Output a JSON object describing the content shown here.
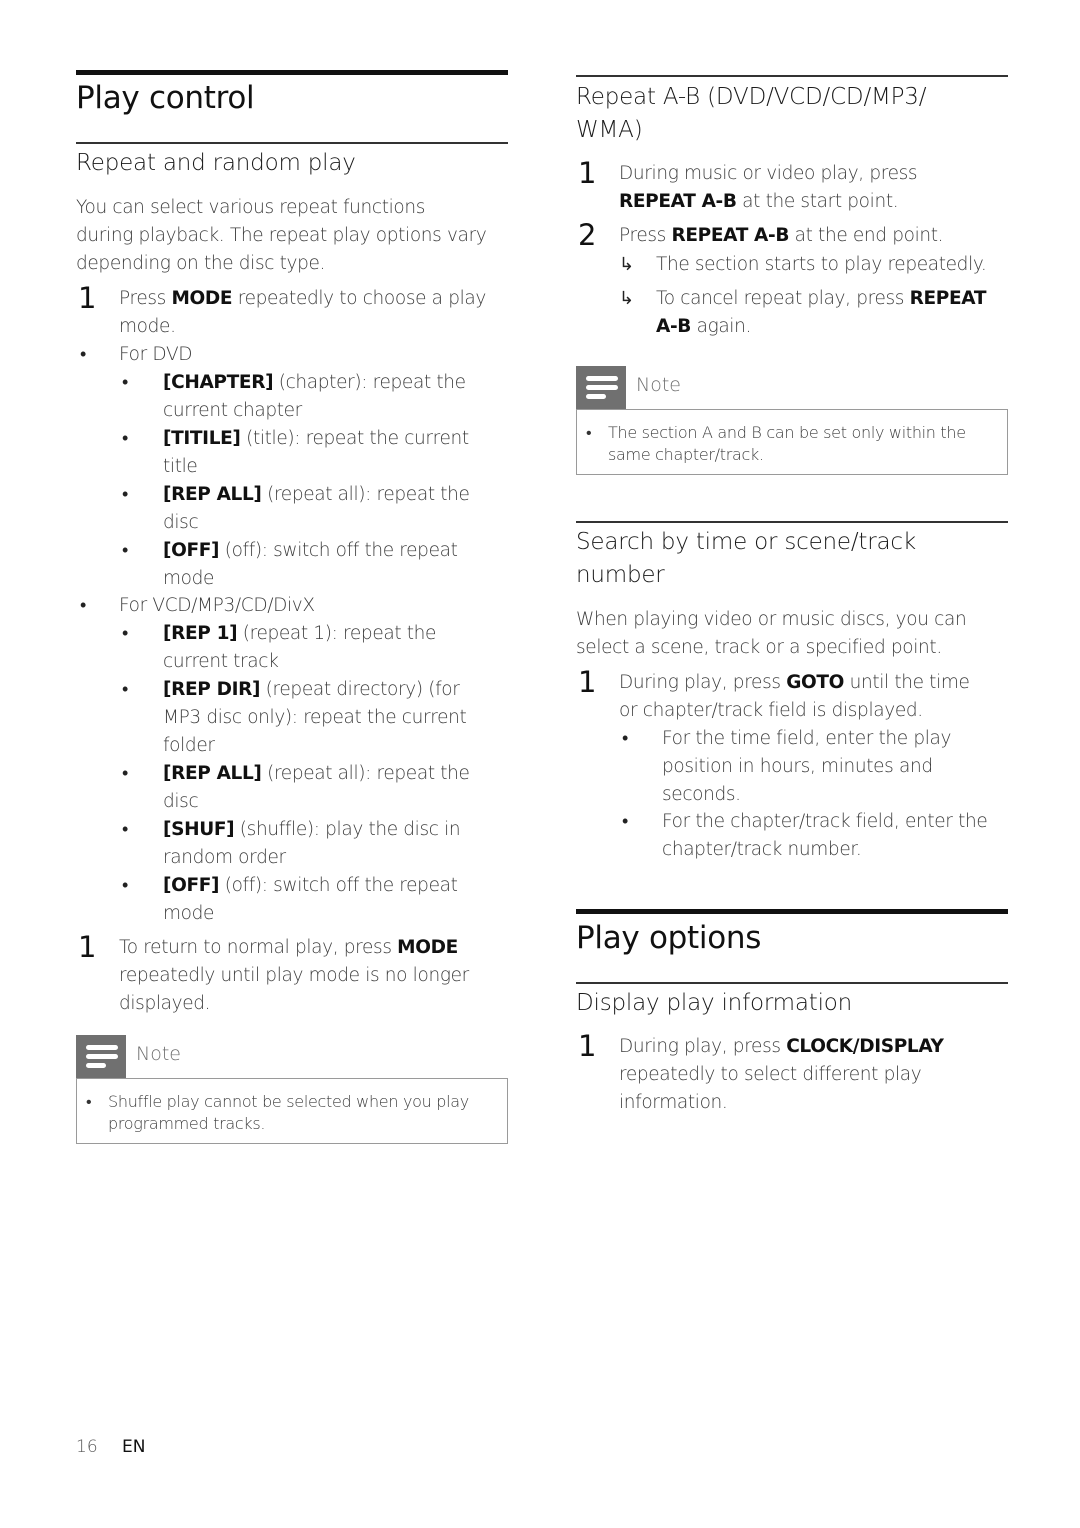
{
  "left": {
    "title": "Play control",
    "section_title": "Repeat and random play",
    "intro": [
      "You can select various repeat functions",
      "during playback. The repeat play options vary",
      "depending on the disc type."
    ],
    "step1": {
      "num": "1",
      "pre": "Press ",
      "key": "MODE",
      "post": " repeatedly to choose a play",
      "line2": "mode."
    },
    "group_dvd": {
      "label": "For DVD",
      "items": [
        {
          "key": "[CHAPTER]",
          "desc": " (chapter): repeat the",
          "line2": "current chapter"
        },
        {
          "key": "[TITILE]",
          "desc": " (title): repeat the current",
          "line2": "title"
        },
        {
          "key": "[REP ALL]",
          "desc": " (repeat all): repeat the",
          "line2": "disc"
        },
        {
          "key": "[OFF]",
          "desc": " (off): switch off the repeat",
          "line2": "mode"
        }
      ]
    },
    "group_vcd": {
      "label": "For VCD/MP3/CD/DivX",
      "items": [
        {
          "key": "[REP 1]",
          "desc": " (repeat 1): repeat the",
          "line2": "current track"
        },
        {
          "key": "[REP DIR]",
          "desc": " (repeat directory) (for",
          "line2": "MP3 disc only): repeat the current",
          "line3": "folder"
        },
        {
          "key": "[REP ALL]",
          "desc": " (repeat all): repeat the",
          "line2": "disc"
        },
        {
          "key": "[SHUF]",
          "desc": " (shuffle): play the disc in",
          "line2": "random order"
        },
        {
          "key": "[OFF]",
          "desc": " (off): switch off the repeat",
          "line2": "mode"
        }
      ]
    },
    "step2": {
      "num": "1",
      "pre": "To return to normal play, press ",
      "key": "MODE",
      "line2": "repeatedly until play mode is no longer",
      "line3": "displayed."
    },
    "note": {
      "title": "Note",
      "bullet": "•",
      "lines": [
        "Shuffle play cannot be selected when you play",
        "programmed tracks."
      ]
    }
  },
  "right": {
    "ab": {
      "title_lines": [
        "Repeat A-B (DVD/VCD/CD/MP3/",
        "WMA)"
      ],
      "step1": {
        "num": "1",
        "line1": "During music or video play, press",
        "key": "REPEAT A-B",
        "post": " at the start point."
      },
      "step2": {
        "num": "2",
        "pre": "Press ",
        "key": "REPEAT A-B",
        "post": " at the end point."
      },
      "result1": "The section starts to play repeatedly.",
      "result2": {
        "pre": "To cancel repeat play, press ",
        "key": "REPEAT",
        "key2": "A-B",
        "post": " again."
      },
      "arrow": "↳",
      "note": {
        "title": "Note",
        "bullet": "•",
        "lines": [
          "The section A and B can be set only within the",
          "same chapter/track."
        ]
      }
    },
    "search": {
      "title_lines": [
        "Search by time or scene/track",
        "number"
      ],
      "intro": [
        "When playing video or music discs, you can",
        "select a scene, track or a specified point."
      ],
      "step1": {
        "num": "1",
        "pre": "During play, press ",
        "key": "GOTO",
        "post": " until the time",
        "line2": "or chapter/track field is displayed."
      },
      "bullets": [
        {
          "lines": [
            "For the time field, enter the play",
            "position in hours, minutes and",
            "seconds."
          ]
        },
        {
          "lines": [
            "For the chapter/track field, enter the",
            "chapter/track number."
          ]
        }
      ]
    },
    "options": {
      "title": "Play options",
      "section_title": "Display play information",
      "step1": {
        "num": "1",
        "pre": "During play, press ",
        "key": "CLOCK/DISPLAY",
        "line2": "repeatedly to select different play",
        "line3": "information."
      }
    }
  },
  "footer": {
    "page": "16",
    "lang": "EN"
  },
  "icons": {
    "note": "note-lines-icon",
    "bullet": "•"
  }
}
